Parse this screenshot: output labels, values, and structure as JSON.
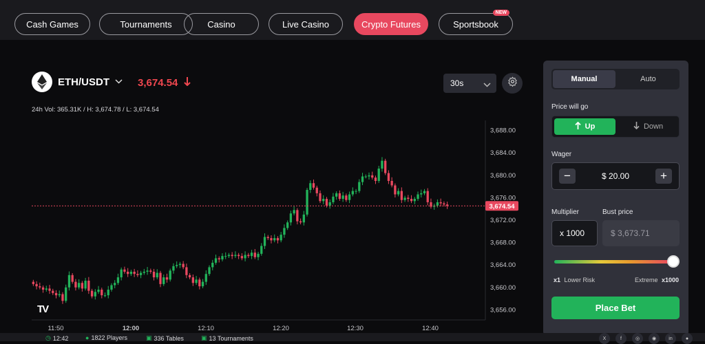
{
  "nav": {
    "items": [
      {
        "label": "Cash Games",
        "active": false
      },
      {
        "label": "Tournaments",
        "active": false
      },
      {
        "label": "Casino",
        "active": false
      },
      {
        "label": "Live Casino",
        "active": false
      },
      {
        "label": "Crypto Futures",
        "active": true
      },
      {
        "label": "Sportsbook",
        "active": false,
        "badge": "NEW"
      }
    ]
  },
  "ticker": {
    "pair": "ETH/USDT",
    "price": "3,674.54",
    "direction": "down",
    "stats": "24h Vol: 365.31K / H: 3,674.78 / L: 3,674.54",
    "interval": "30s"
  },
  "chart_data": {
    "type": "candlestick",
    "y_ticks": [
      "3,688.00",
      "3,684.00",
      "3,680.00",
      "3,676.00",
      "3,672.00",
      "3,668.00",
      "3,664.00",
      "3,660.00",
      "3,656.00"
    ],
    "y_values": [
      3688,
      3684,
      3680,
      3676,
      3672,
      3668,
      3664,
      3660,
      3656
    ],
    "x_ticks": [
      "11:50",
      "12:00",
      "12:10",
      "12:20",
      "12:30",
      "12:40"
    ],
    "current_price_label": "3,674.54",
    "current_price": 3674.54,
    "ylim": [
      3654.2,
      3689.8
    ],
    "up_color": "#22b35a",
    "down_color": "#e8485f",
    "close_series": [
      3660.6,
      3660.2,
      3660.0,
      3659.6,
      3659.8,
      3659.4,
      3659.0,
      3658.6,
      3658.8,
      3657.6,
      3660.0,
      3662.2,
      3661.0,
      3660.0,
      3660.8,
      3659.8,
      3661.2,
      3659.4,
      3658.4,
      3659.2,
      3659.6,
      3658.6,
      3658.6,
      3659.6,
      3660.4,
      3660.8,
      3661.8,
      3663.2,
      3662.8,
      3662.4,
      3662.8,
      3662.4,
      3662.2,
      3662.6,
      3662.8,
      3663.0,
      3662.8,
      3661.8,
      3662.6,
      3660.6,
      3661.8,
      3661.4,
      3663.0,
      3663.8,
      3664.0,
      3664.2,
      3663.6,
      3662.2,
      3661.8,
      3660.8,
      3661.4,
      3660.2,
      3661.0,
      3662.4,
      3663.6,
      3664.4,
      3665.2,
      3665.0,
      3665.6,
      3665.6,
      3665.8,
      3665.6,
      3665.8,
      3665.6,
      3665.2,
      3665.8,
      3665.6,
      3666.2,
      3665.4,
      3666.0,
      3667.4,
      3669.0,
      3668.8,
      3668.4,
      3668.8,
      3668.4,
      3669.4,
      3670.6,
      3671.6,
      3673.2,
      3673.8,
      3671.8,
      3671.6,
      3673.0,
      3677.4,
      3678.6,
      3677.8,
      3676.8,
      3675.4,
      3675.8,
      3674.6,
      3675.2,
      3676.2,
      3676.8,
      3675.8,
      3676.4,
      3675.6,
      3676.6,
      3677.2,
      3677.2,
      3678.8,
      3679.8,
      3679.8,
      3680.0,
      3679.6,
      3679.0,
      3681.2,
      3682.6,
      3680.4,
      3679.0,
      3678.2,
      3676.6,
      3677.2,
      3675.6,
      3676.0,
      3675.8,
      3675.4,
      3675.8,
      3676.6,
      3676.8,
      3677.2,
      3675.2,
      3674.4,
      3674.6,
      3675.2,
      3675.0,
      3674.8,
      3674.54
    ]
  },
  "panel": {
    "mode_manual": "Manual",
    "mode_auto": "Auto",
    "direction_label": "Price will go",
    "up_label": "Up",
    "down_label": "Down",
    "wager_label": "Wager",
    "wager_value": "$ 20.00",
    "minus": "−",
    "plus": "+",
    "multiplier_label": "Multiplier",
    "bust_label": "Bust price",
    "multiplier_value": "x 1000",
    "bust_value": "$ 3,673.71",
    "risk_min": "x1",
    "risk_min_label": "Lower Risk",
    "risk_max_label": "Extreme",
    "risk_max": "x1000",
    "slider_value": 1.0,
    "place_bet": "Place Bet"
  },
  "footer": {
    "time": "12:42",
    "players": "1822 Players",
    "tables": "336 Tables",
    "tournaments": "13 Tournaments",
    "social": [
      "x-icon",
      "facebook-icon",
      "instagram-icon",
      "discord-icon",
      "linkedin-icon",
      "reddit-icon"
    ]
  }
}
